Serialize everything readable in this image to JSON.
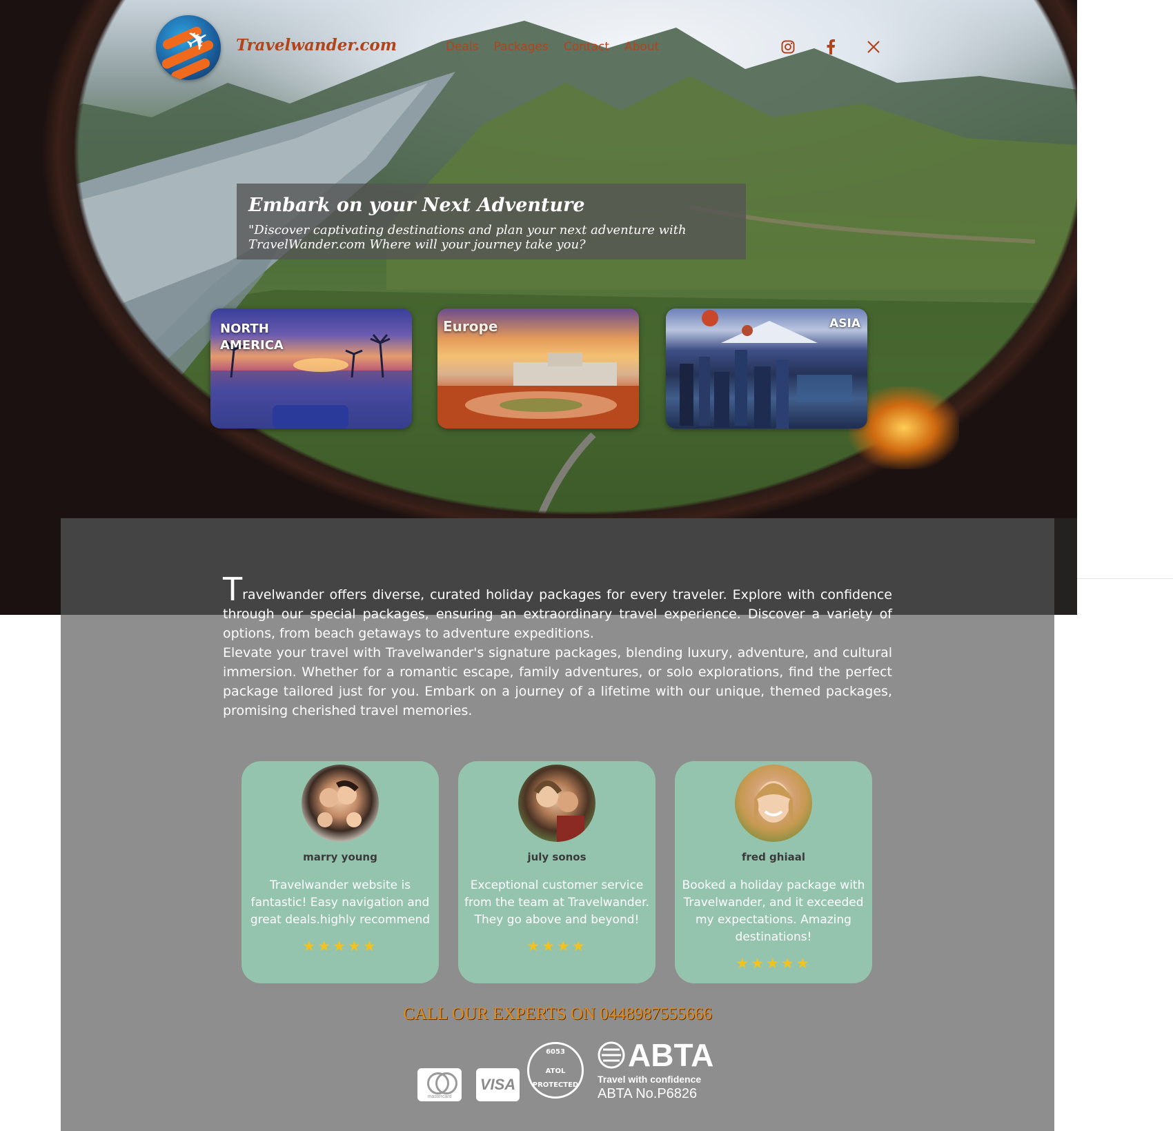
{
  "header": {
    "brand": "Travelwander.com",
    "nav": [
      "Deals",
      "Packages",
      "Contact",
      "About"
    ],
    "social": [
      "instagram-icon",
      "facebook-icon",
      "x-icon"
    ]
  },
  "hero": {
    "title": "Embark on your Next Adventure",
    "subtitle": "\"Discover captivating destinations and plan your next adventure with TravelWander.com Where will your journey take you?"
  },
  "destinations": [
    {
      "label_line1": "NORTH",
      "label_line2": "AMERICA"
    },
    {
      "label": "Europe"
    },
    {
      "label": "ASIA"
    }
  ],
  "intro": {
    "drop_cap": "T",
    "paragraph1_rest": "ravelwander offers diverse, curated holiday packages for every traveler. Explore with confidence through our special packages, ensuring an extraordinary travel experience. Discover a variety of options, from beach getaways to adventure expeditions.",
    "paragraph2": "Elevate your travel with Travelwander's signature packages, blending luxury, adventure, and cultural immersion. Whether for a romantic escape, family adventures, or solo explorations, find the perfect package tailored just for you. Embark on a journey of a lifetime with our unique, themed packages, promising cherished travel memories."
  },
  "reviews": [
    {
      "name": "marry young",
      "text": "Travelwander website is fantastic! Easy navigation and great deals.highly recommend",
      "stars": "★★★★★",
      "rating": 5
    },
    {
      "name": "july sonos",
      "text": "Exceptional customer service from the team at Travelwander. They go above and beyond!",
      "stars": "★★★★",
      "rating": 4
    },
    {
      "name": "fred ghiaal",
      "text": "Booked a holiday package with Travelwander, and it exceeded my expectations. Amazing destinations!",
      "stars": "★★★★★",
      "rating": 5
    }
  ],
  "call": "CALL OUR EXPERTS ON 0448987555666",
  "badges": {
    "mastercard": "mastercard",
    "visa": "VISA",
    "atol_number": "6053",
    "atol_mid": "ATOL",
    "atol_bottom": "PROTECTED",
    "abta": "ABTA",
    "abta_tagline": "Travel with confidence",
    "abta_number": "ABTA No.P6826"
  },
  "colors": {
    "brand": "#b2441c",
    "panel": "#8e8e8e",
    "card": "#94c4ae",
    "star": "#f4c21c",
    "call": "#e08a1e"
  }
}
